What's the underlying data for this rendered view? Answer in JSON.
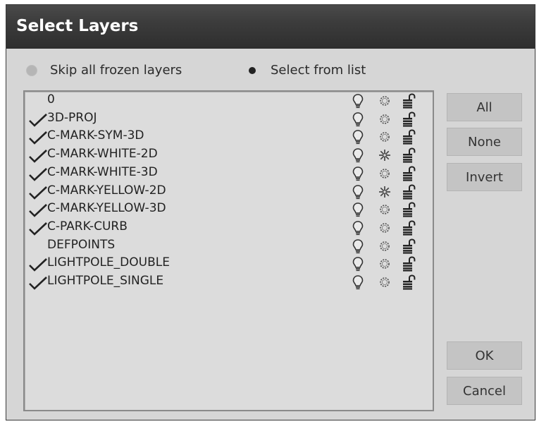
{
  "dialog": {
    "title": "Select Layers",
    "radio_skip_label": "Skip all frozen layers",
    "radio_skip_selected": false,
    "radio_select_label": "Select from list",
    "radio_select_selected": true
  },
  "buttons": {
    "all": "All",
    "none": "None",
    "invert": "Invert",
    "ok": "OK",
    "cancel": "Cancel"
  },
  "layers": [
    {
      "name": "0",
      "checked": false,
      "frozen": false
    },
    {
      "name": "3D-PROJ",
      "checked": true,
      "frozen": false
    },
    {
      "name": "C-MARK-SYM-3D",
      "checked": true,
      "frozen": false
    },
    {
      "name": "C-MARK-WHITE-2D",
      "checked": true,
      "frozen": true
    },
    {
      "name": "C-MARK-WHITE-3D",
      "checked": true,
      "frozen": false
    },
    {
      "name": "C-MARK-YELLOW-2D",
      "checked": true,
      "frozen": true
    },
    {
      "name": "C-MARK-YELLOW-3D",
      "checked": true,
      "frozen": false
    },
    {
      "name": "C-PARK-CURB",
      "checked": true,
      "frozen": false
    },
    {
      "name": "DEFPOINTS",
      "checked": false,
      "frozen": false
    },
    {
      "name": "LIGHTPOLE_DOUBLE",
      "checked": true,
      "frozen": false
    },
    {
      "name": "LIGHTPOLE_SINGLE",
      "checked": true,
      "frozen": false
    }
  ],
  "icons": {
    "on_off": "lightbulb-icon",
    "thawed": "sun-icon",
    "frozen": "snowflake-icon",
    "lock": "unlocked-padlock-icon",
    "check": "checkmark-icon"
  }
}
